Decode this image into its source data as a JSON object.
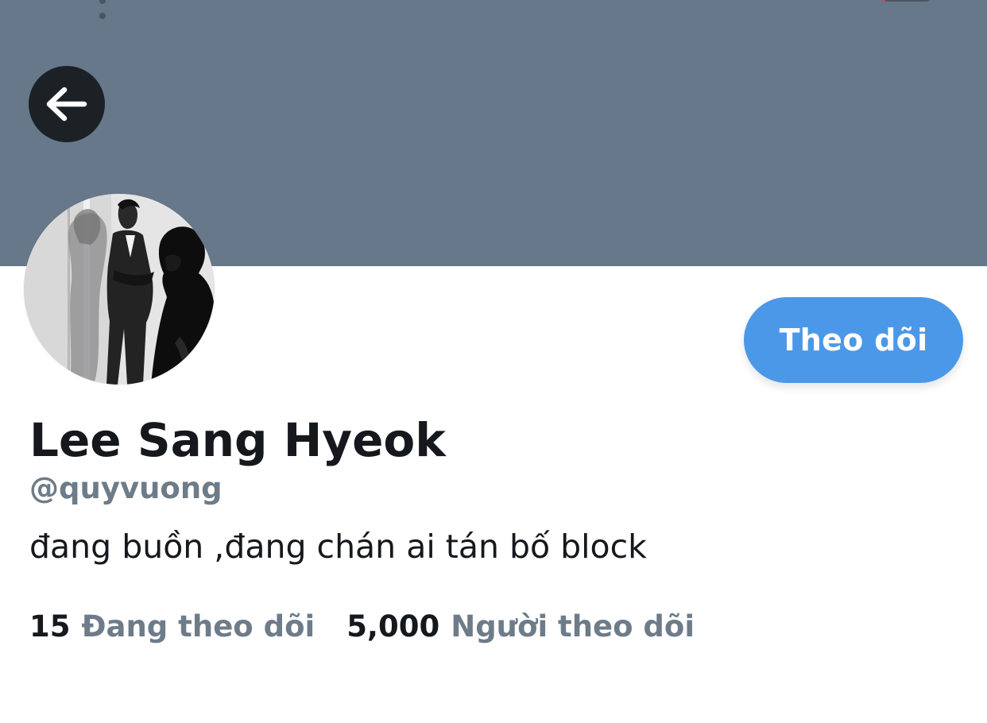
{
  "profile": {
    "display_name": "Lee Sang Hyeok",
    "handle": "@quyvuong",
    "bio": "đang buồn ,đang chán ai tán bố block",
    "follow_button_label": "Theo dõi",
    "following_count": "15",
    "following_label": "Đang theo dõi",
    "followers_count": "5,000",
    "followers_label": "Người theo dõi"
  },
  "icons": {
    "back": "arrow-left-icon"
  },
  "colors": {
    "banner": "#67788a",
    "accent": "#4b98e9",
    "secondary_text": "#6e7c89",
    "primary_text": "#15181c"
  }
}
